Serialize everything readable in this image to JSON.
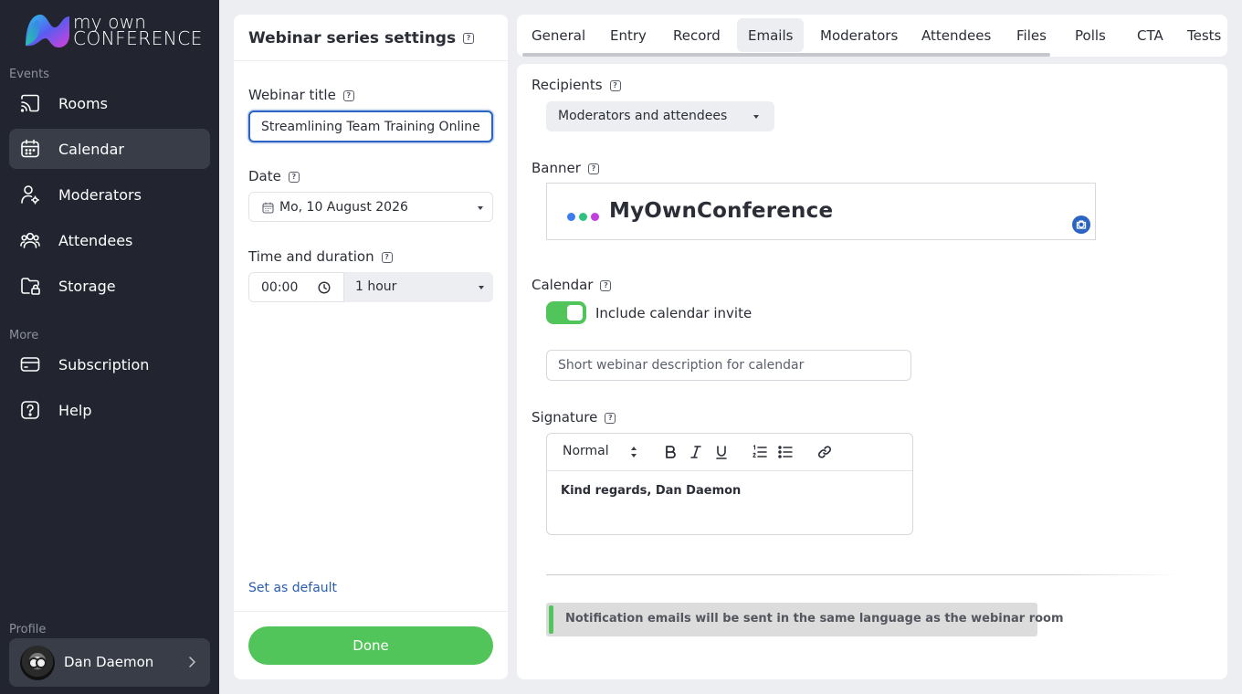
{
  "logo": {
    "line1": "my own",
    "line2": "CONFERENCE"
  },
  "sidebar": {
    "section_events": "Events",
    "section_more": "More",
    "section_profile": "Profile",
    "items": [
      {
        "label": "Rooms",
        "icon": "cast-icon"
      },
      {
        "label": "Calendar",
        "icon": "calendar-icon",
        "active": true
      },
      {
        "label": "Moderators",
        "icon": "user-gear-icon"
      },
      {
        "label": "Attendees",
        "icon": "users-icon"
      },
      {
        "label": "Storage",
        "icon": "folder-lock-icon"
      },
      {
        "label": "Subscription",
        "icon": "credit-card-icon"
      },
      {
        "label": "Help",
        "icon": "help-icon"
      }
    ],
    "profile_name": "Dan Daemon"
  },
  "settings": {
    "title": "Webinar series settings",
    "webinar_title_label": "Webinar title",
    "webinar_title_value": "Streamlining Team Training Online",
    "date_label": "Date",
    "date_value": "Mo, 10 August 2026",
    "time_label": "Time and duration",
    "time_value": "00:00",
    "duration_value": "1 hour",
    "set_default": "Set as default",
    "done": "Done"
  },
  "tabs": [
    "General",
    "Entry",
    "Record",
    "Emails",
    "Moderators",
    "Attendees",
    "Files",
    "Polls",
    "CTA",
    "Tests"
  ],
  "active_tab": "Emails",
  "emails": {
    "recipients_label": "Recipients",
    "recipients_value": "Moderators and attendees",
    "banner_label": "Banner",
    "banner_text": "MyOwnConference",
    "calendar_label": "Calendar",
    "calendar_toggle_on": true,
    "calendar_toggle_label": "Include calendar invite",
    "calendar_desc_placeholder": "Short webinar description for calendar",
    "signature_label": "Signature",
    "format_value": "Normal",
    "signature_text": "Kind regards, Dan Daemon",
    "notice": "Notification emails will be sent in the same language as the webinar room"
  },
  "colors": {
    "sidebar_bg": "#22252f",
    "accent_green": "#52c55a",
    "link_blue": "#2a5db0",
    "focus_blue": "#2b64c2",
    "banner_dot_1": "#3c7bf0",
    "banner_dot_2": "#2ec27e",
    "banner_dot_3": "#c23fe0"
  }
}
